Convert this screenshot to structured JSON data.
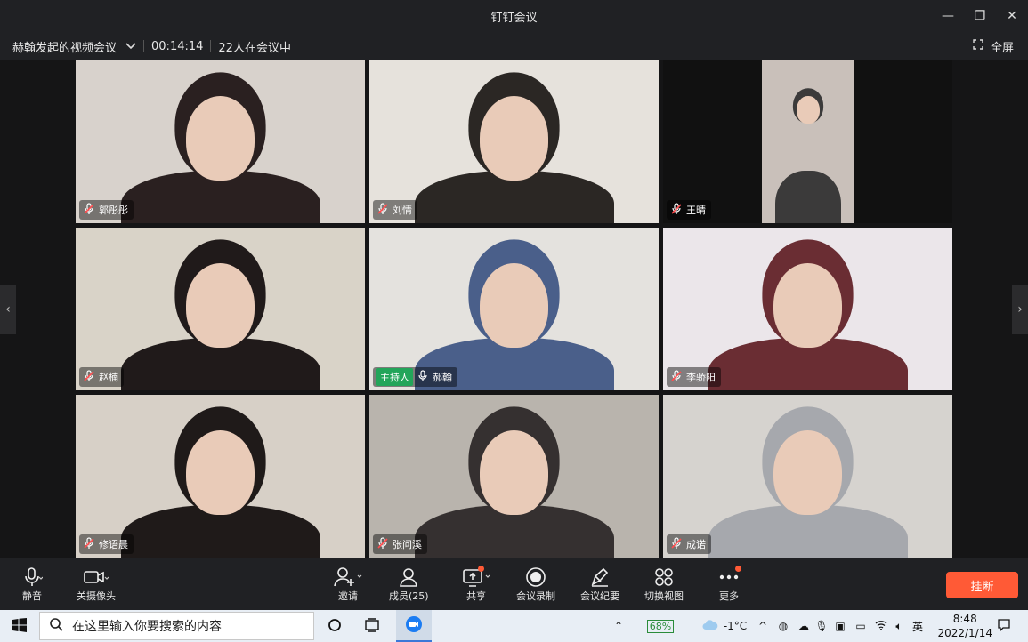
{
  "window": {
    "title": "钉钉会议"
  },
  "infobar": {
    "meeting_name": "赫翰发起的视频会议",
    "elapsed": "00:14:14",
    "participants_text": "22人在会议中",
    "fullscreen_label": "全屏"
  },
  "tiles": [
    {
      "name": "郭彤彤",
      "mic": "muted",
      "bg": "#d8d2cc",
      "person": "#2a2020"
    },
    {
      "name": "刘情",
      "mic": "muted",
      "bg": "#e6e2dc",
      "person": "#2b2724"
    },
    {
      "name": "王晴",
      "mic": "muted",
      "bg": "#c9c0ba",
      "person": "#3b3a3a"
    },
    {
      "name": "赵楠",
      "mic": "muted",
      "bg": "#d9d3c8",
      "person": "#201a1a"
    },
    {
      "name": "郝翰",
      "mic": "on",
      "host": "主持人",
      "bg": "#e4e2de",
      "person": "#4a5f8a"
    },
    {
      "name": "李骄阳",
      "mic": "muted",
      "bg": "#ebe6ea",
      "person": "#6a2d33"
    },
    {
      "name": "修语晨",
      "mic": "muted",
      "bg": "#d7d0c7",
      "person": "#1f1a19"
    },
    {
      "name": "张问溪",
      "mic": "muted",
      "bg": "#b9b4ad",
      "person": "#353030"
    },
    {
      "name": "成诺",
      "mic": "muted",
      "bg": "#d6d3cf",
      "person": "#a6a8ad"
    }
  ],
  "toolbar": {
    "mute": "静音",
    "camera": "关摄像头",
    "invite": "邀请",
    "members": "成员(25)",
    "share": "共享",
    "record": "会议录制",
    "minutes": "会议纪要",
    "switch_view": "切换视图",
    "more": "更多",
    "hangup": "挂断"
  },
  "taskbar": {
    "search_placeholder": "在这里输入你要搜索的内容",
    "battery": "68%",
    "weather": "-1°C",
    "ime": "英",
    "time": "8:48",
    "date": "2022/1/14"
  },
  "colors": {
    "accent_red": "#ff5a36",
    "host_green": "#23a55a"
  }
}
